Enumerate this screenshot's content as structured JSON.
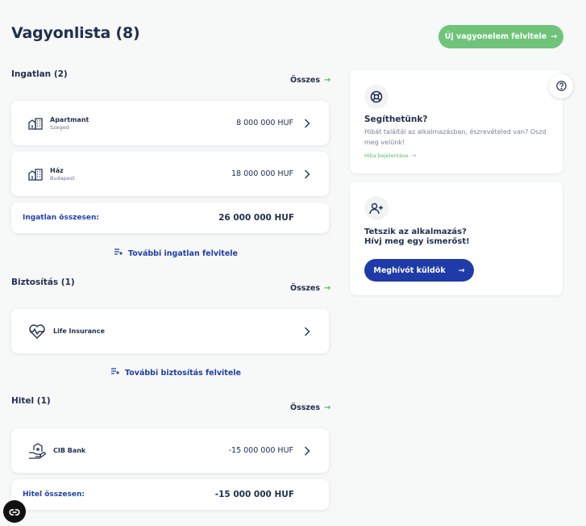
{
  "header": {
    "title": "Vagyonlista (8)",
    "new_button_label": "Új vagyonelem felvitele",
    "new_button_arrow": "→"
  },
  "all_label": "Összes",
  "arrow": "→",
  "real_estate": {
    "title": "Ingatlan (2)",
    "items": [
      {
        "name": "Apartmant",
        "location": "Szeged",
        "value": "8 000 000 HUF",
        "icon": "building-icon"
      },
      {
        "name": "Ház",
        "location": "Budapest",
        "value": "18 000 000 HUF",
        "icon": "building-icon"
      }
    ],
    "total_label": "Ingatlan összesen:",
    "total_value": "26 000 000 HUF",
    "add_label": "További ingatlan felvitele"
  },
  "insurance": {
    "title": "Biztosítás (1)",
    "items": [
      {
        "name": "Life Insurance",
        "icon": "heartbeat-icon"
      }
    ],
    "add_label": "További biztosítás felvitele"
  },
  "loan": {
    "title": "Hitel (1)",
    "items": [
      {
        "name": "CIB Bank",
        "value": "-15 000 000 HUF",
        "icon": "hand-house-icon"
      }
    ],
    "total_label": "Hitel összesen:",
    "total_value": "-15 000 000 HUF"
  },
  "help_card": {
    "title": "Segíthetünk?",
    "text": "Hibát találtál az alkalmazásban, észrevételed van? Oszd meg velünk!",
    "link_label": "Hiba bejelentése",
    "icon": "lifebuoy-icon"
  },
  "invite_card": {
    "title_line1": "Tetszik az alkalmazás?",
    "title_line2": "Hívj meg egy ismerőst!",
    "button_label": "Meghívót küldök",
    "icon": "add-user-icon"
  },
  "colors": {
    "accent_green": "#6fc47a",
    "primary_blue": "#1e3ba8",
    "text_dark": "#22304f",
    "background": "#f7f8f8"
  }
}
